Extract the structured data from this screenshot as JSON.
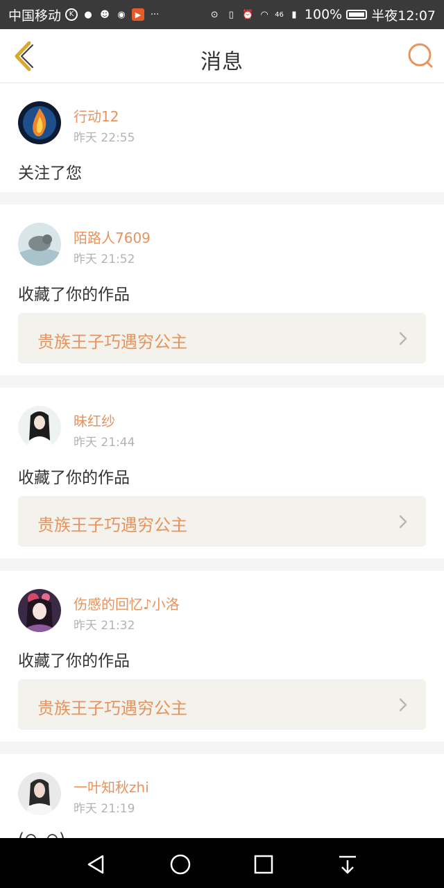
{
  "status_bar": {
    "carrier": "中国移动",
    "signal_label": "46",
    "battery": "100%",
    "time": "半夜12:07"
  },
  "header": {
    "title": "消息"
  },
  "messages": [
    {
      "username": "行动12",
      "time": "昨天 22:55",
      "action": "关注了您"
    },
    {
      "username": "陌路人7609",
      "time": "昨天 21:52",
      "action": "收藏了你的作品",
      "work_title": "贵族王子巧遇穷公主"
    },
    {
      "username": "昧红纱",
      "time": "昨天 21:44",
      "action": "收藏了你的作品",
      "work_title": "贵族王子巧遇穷公主"
    },
    {
      "username": "伤感的回忆♪小洛",
      "time": "昨天 21:32",
      "action": "收藏了你的作品",
      "work_title": "贵族王子巧遇穷公主"
    },
    {
      "username": "一叶知秋zhi",
      "time": "昨天 21:19",
      "action": "(⊙_⊙)"
    }
  ],
  "colors": {
    "accent": "#e8935c",
    "back_icon": "#d9a830",
    "work_bg": "#f3f2ec"
  }
}
